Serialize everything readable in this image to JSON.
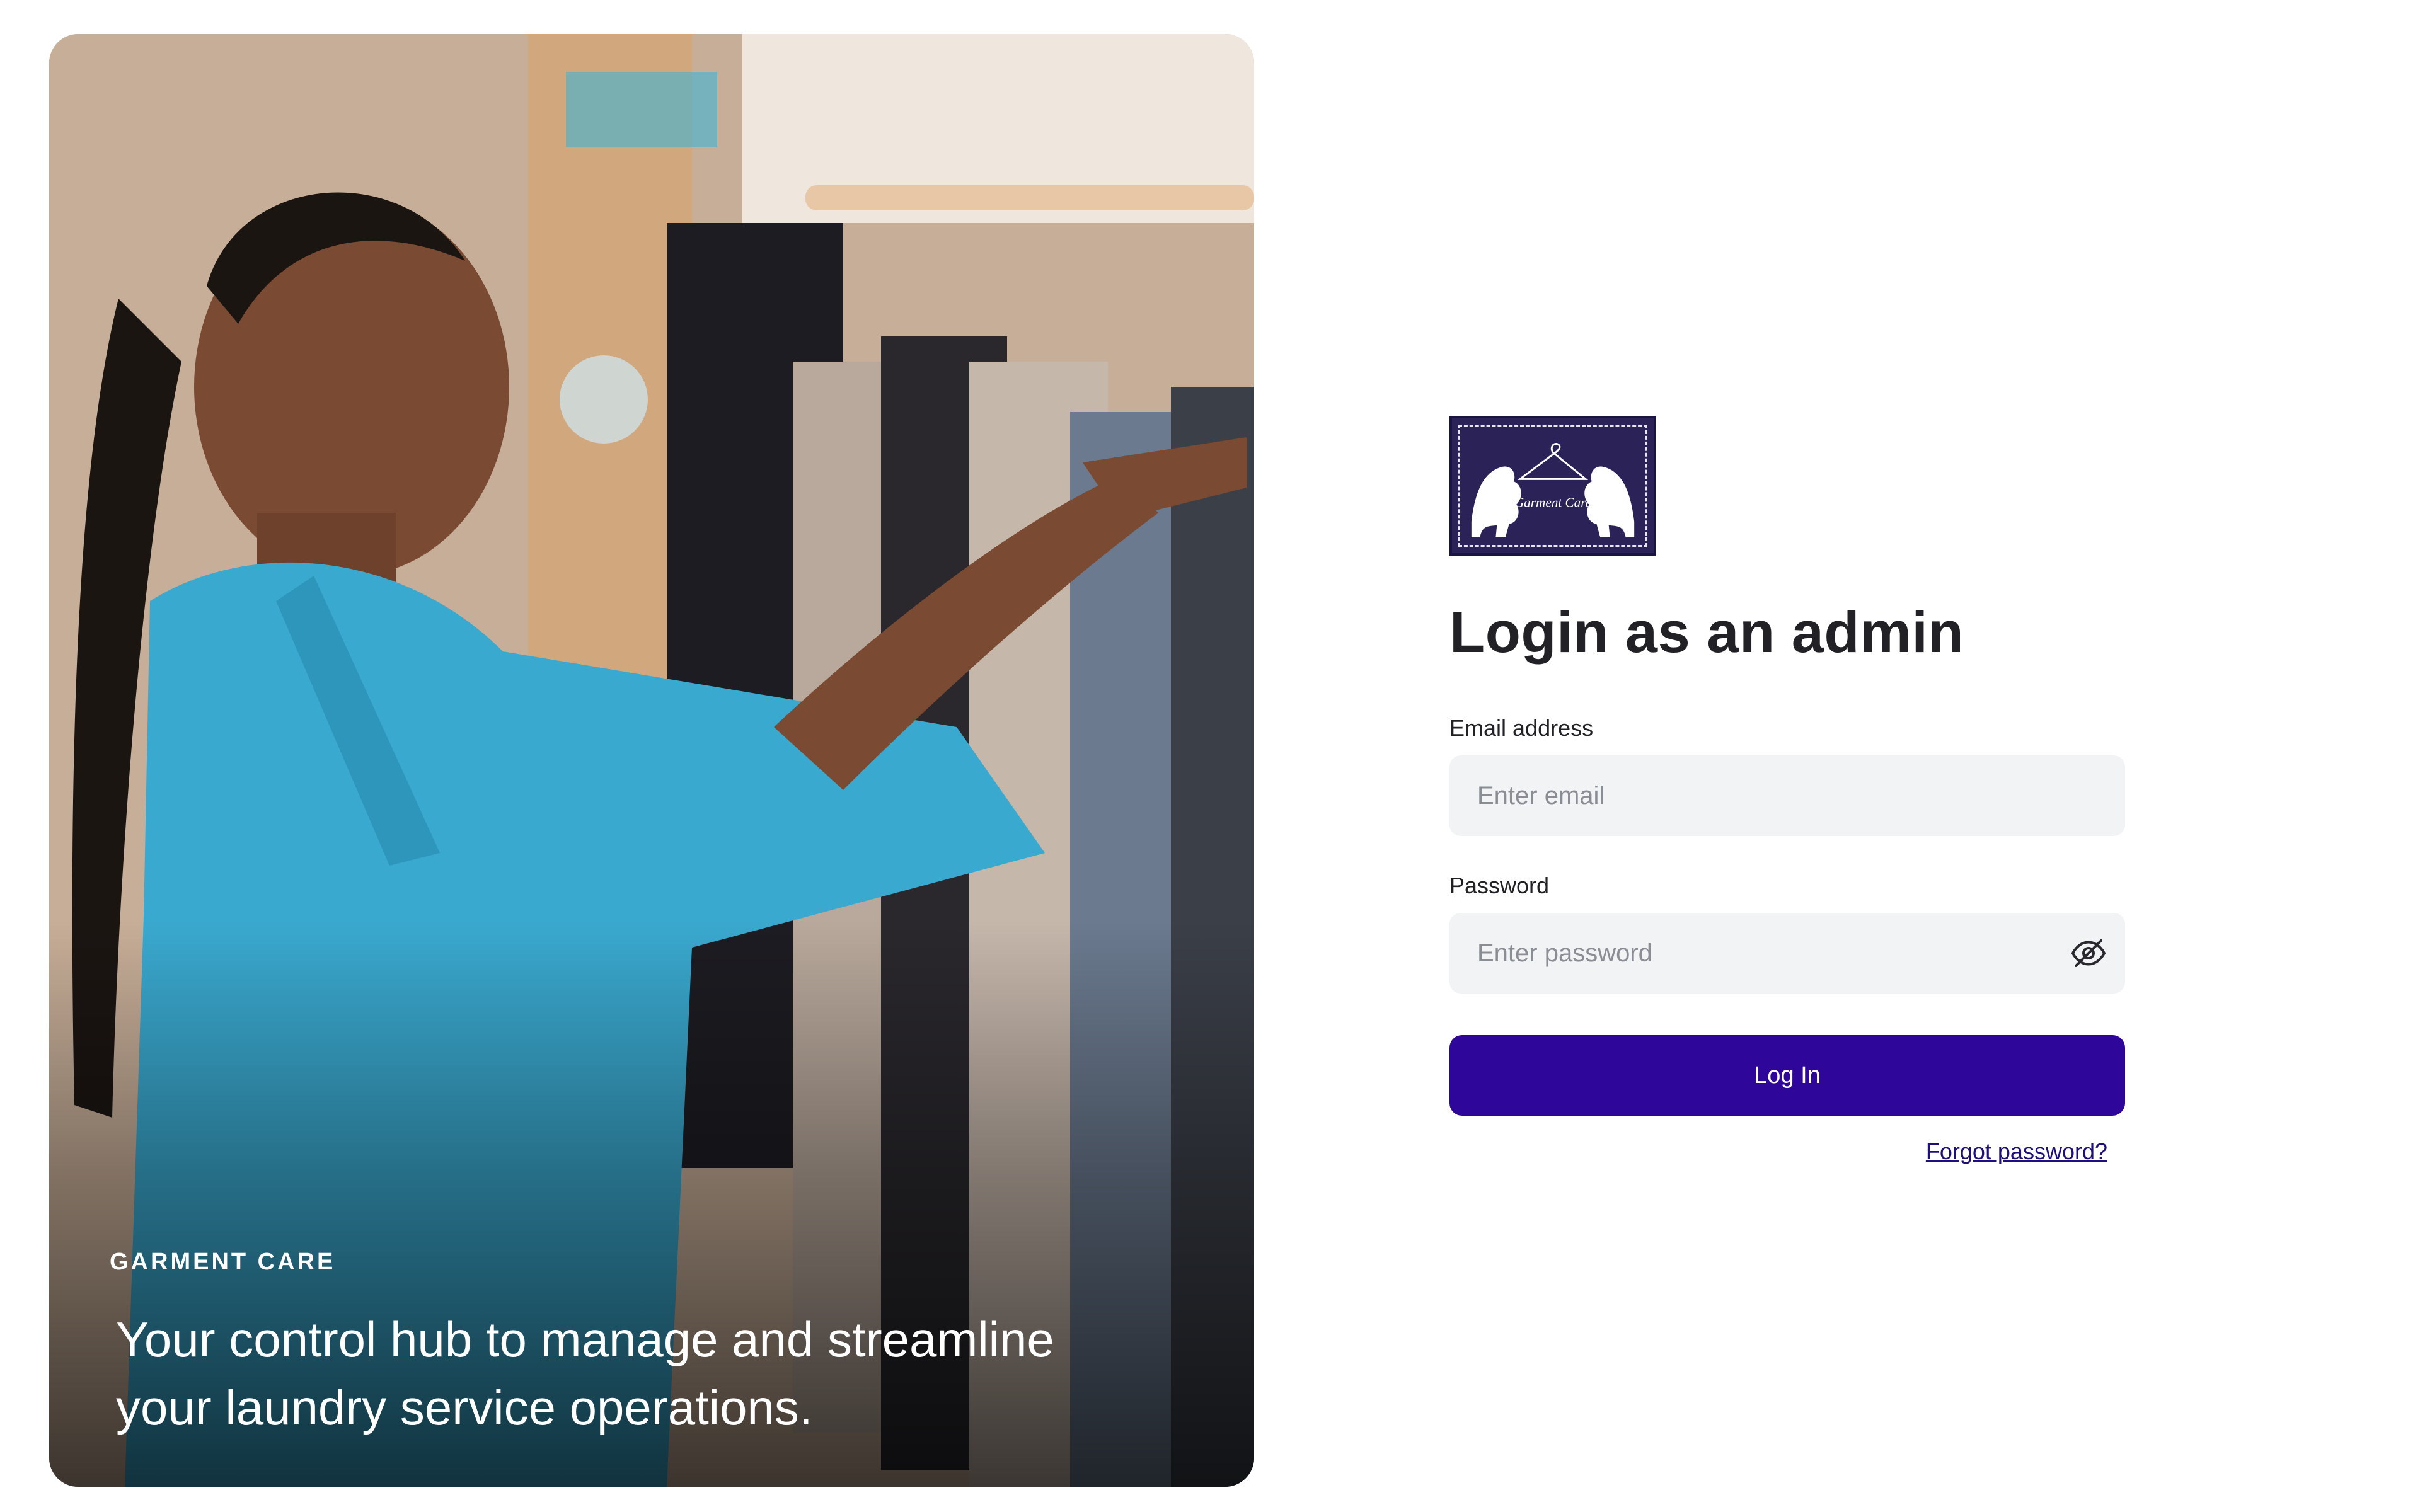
{
  "hero": {
    "brand": "GARMENT CARE",
    "tagline": "Your control hub to manage and streamline your laundry service operations."
  },
  "logo": {
    "text": "Garment Care",
    "icon": "lions-hanger-logo",
    "background_color": "#2b2357"
  },
  "login": {
    "heading": "Login as an admin",
    "email_label": "Email address",
    "email_placeholder": "Enter email",
    "email_value": "",
    "password_label": "Password",
    "password_placeholder": "Enter password",
    "password_value": "",
    "password_toggle_icon": "eye-off-icon",
    "submit_label": "Log In",
    "forgot_label": "Forgot password?"
  },
  "colors": {
    "accent": "#2e0699",
    "link": "#1e0f7a",
    "input_background": "#f2f3f5"
  }
}
